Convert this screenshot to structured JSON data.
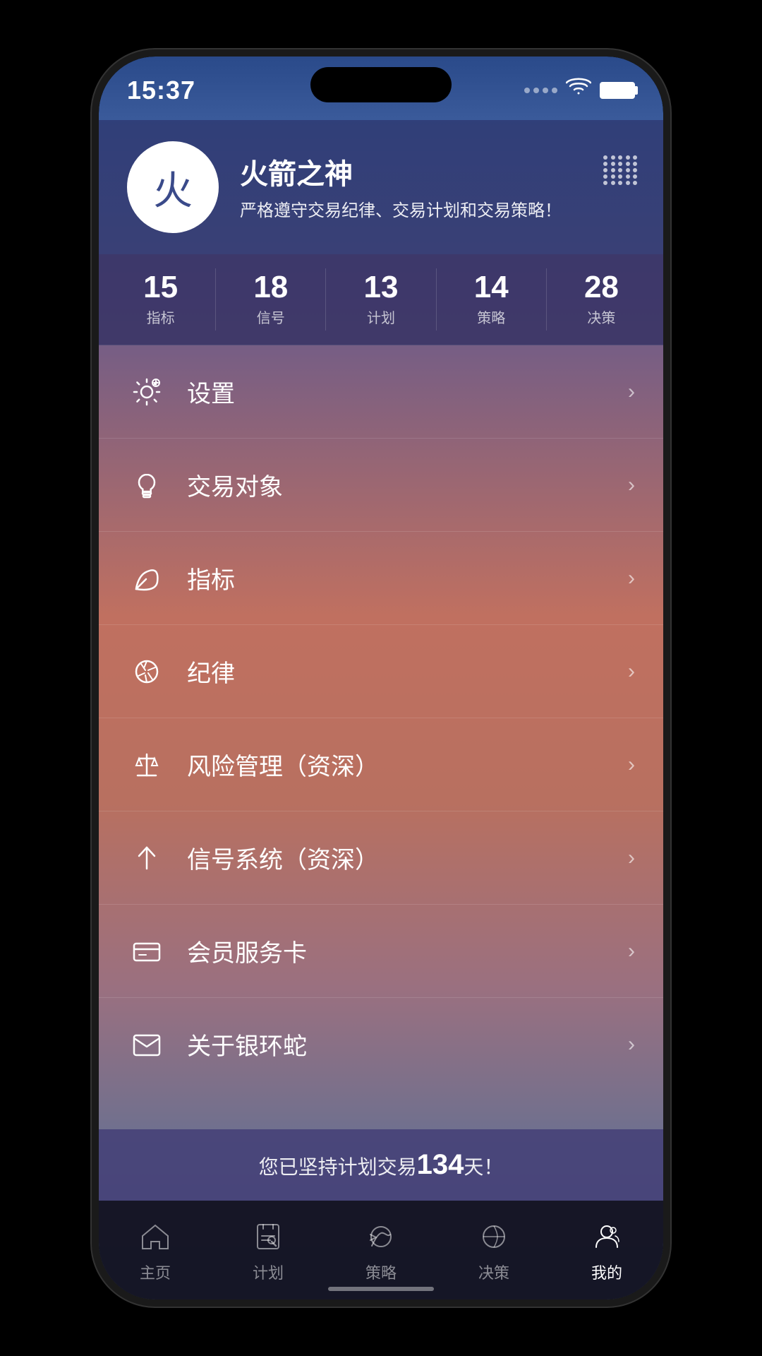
{
  "status_bar": {
    "time": "15:37",
    "signal": "signal",
    "wifi": "wifi",
    "battery": "battery"
  },
  "profile": {
    "avatar_char": "火",
    "name": "火箭之神",
    "motto": "严格遵守交易纪律、交易计划和交易策略！"
  },
  "stats": [
    {
      "number": "15",
      "label": "指标"
    },
    {
      "number": "18",
      "label": "信号"
    },
    {
      "number": "13",
      "label": "计划"
    },
    {
      "number": "14",
      "label": "策略"
    },
    {
      "number": "28",
      "label": "决策"
    }
  ],
  "menu_items": [
    {
      "id": "settings",
      "label": "设置",
      "icon": "gear"
    },
    {
      "id": "trading-target",
      "label": "交易对象",
      "icon": "bulb"
    },
    {
      "id": "indicators",
      "label": "指标",
      "icon": "leaf"
    },
    {
      "id": "discipline",
      "label": "纪律",
      "icon": "aperture"
    },
    {
      "id": "risk-management",
      "label": "风险管理（资深）",
      "icon": "scale"
    },
    {
      "id": "signal-system",
      "label": "信号系统（资深）",
      "icon": "fork"
    },
    {
      "id": "membership",
      "label": "会员服务卡",
      "icon": "card"
    },
    {
      "id": "about",
      "label": "关于银环蛇",
      "icon": "envelope"
    }
  ],
  "banner": {
    "prefix": "您已坚持计划交易",
    "days": "134",
    "suffix": "天！"
  },
  "tabs": [
    {
      "id": "home",
      "label": "主页",
      "active": false
    },
    {
      "id": "plan",
      "label": "计划",
      "active": false
    },
    {
      "id": "strategy",
      "label": "策略",
      "active": false
    },
    {
      "id": "decision",
      "label": "决策",
      "active": false
    },
    {
      "id": "mine",
      "label": "我的",
      "active": true
    }
  ]
}
